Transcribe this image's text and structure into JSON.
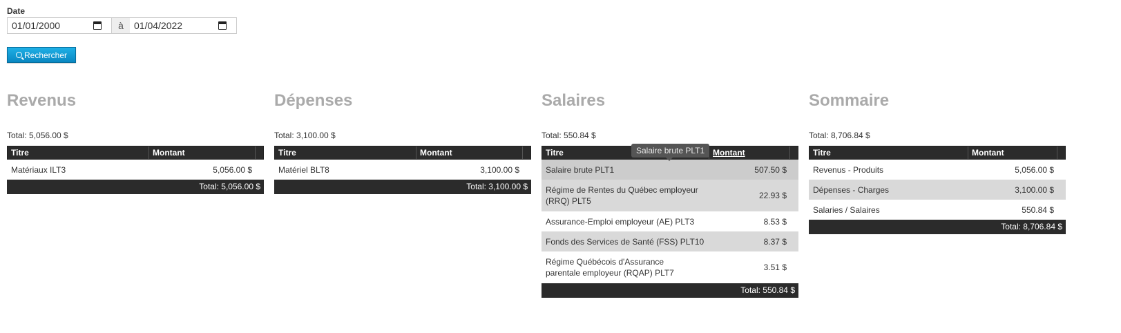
{
  "filter": {
    "label": "Date",
    "date_from": "01/01/2000",
    "separator": "à",
    "date_to": "01/04/2022",
    "search_label": "Rechercher"
  },
  "columns": {
    "title": "Titre",
    "amount": "Montant"
  },
  "revenus": {
    "heading": "Revenus",
    "total_line": "Total: 5,056.00 $",
    "rows": [
      {
        "title": "Matériaux ILT3",
        "amount": "5,056.00 $"
      }
    ],
    "footer": "Total: 5,056.00 $"
  },
  "depenses": {
    "heading": "Dépenses",
    "total_line": "Total: 3,100.00 $",
    "rows": [
      {
        "title": "Matériel BLT8",
        "amount": "3,100.00 $"
      }
    ],
    "footer": "Total: 3,100.00 $"
  },
  "salaires": {
    "heading": "Salaires",
    "total_line": "Total: 550.84 $",
    "tooltip": "Salaire brute PLT1",
    "rows": [
      {
        "title": "Salaire brute PLT1",
        "amount": "507.50 $"
      },
      {
        "title": "Régime de Rentes du Québec employeur (RRQ) PLT5",
        "amount": "22.93 $"
      },
      {
        "title": "Assurance-Emploi employeur (AE) PLT3",
        "amount": "8.53 $"
      },
      {
        "title": "Fonds des Services de Santé (FSS) PLT10",
        "amount": "8.37 $"
      },
      {
        "title": "Régime Québécois d'Assurance parentale employeur (RQAP) PLT7",
        "amount": "3.51 $"
      }
    ],
    "footer": "Total: 550.84 $"
  },
  "sommaire": {
    "heading": "Sommaire",
    "total_line": "Total: 8,706.84 $",
    "rows": [
      {
        "title": "Revenus - Produits",
        "amount": "5,056.00 $"
      },
      {
        "title": "Dépenses - Charges",
        "amount": "3,100.00 $"
      },
      {
        "title": "Salaries / Salaires",
        "amount": "550.84 $"
      }
    ],
    "footer": "Total: 8,706.84 $"
  }
}
